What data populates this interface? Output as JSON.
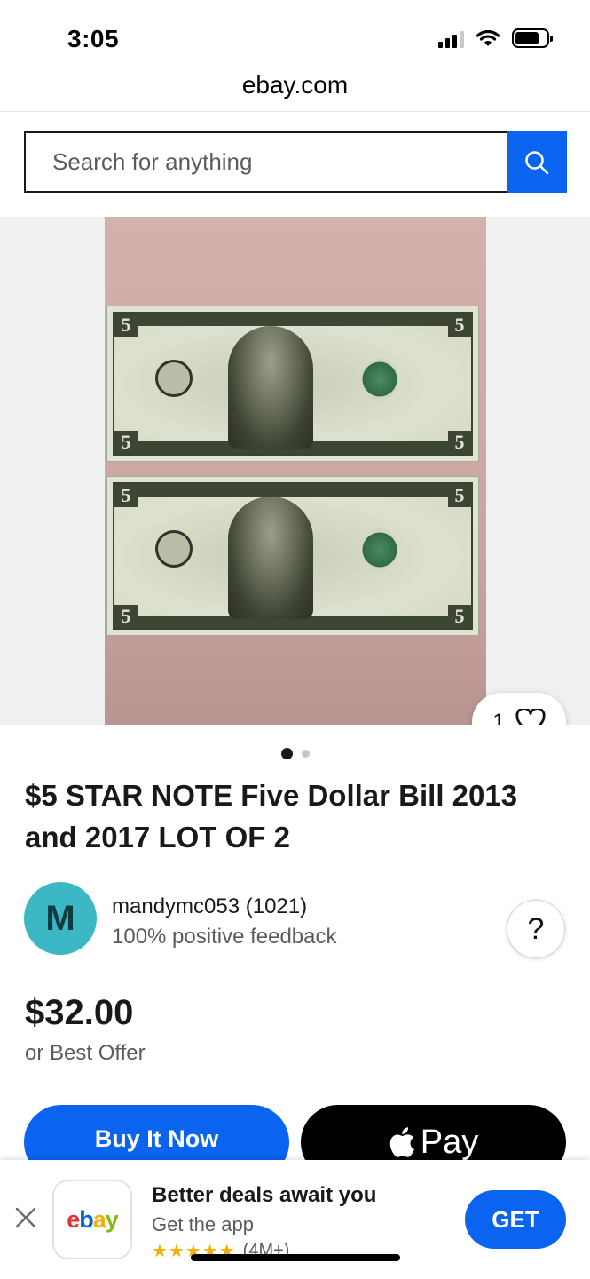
{
  "status_bar": {
    "time": "3:05",
    "battery_level": 0.75
  },
  "browser": {
    "url": "ebay.com"
  },
  "search": {
    "placeholder": "Search for anything",
    "button_icon": "search-icon"
  },
  "gallery": {
    "watch_count": "1",
    "watch_icon": "heart-icon",
    "total_images": 2,
    "active_image": 1
  },
  "listing": {
    "title": "$5 STAR NOTE Five Dollar Bill 2013 and 2017 LOT OF 2",
    "price": "$32.00",
    "best_offer": "or Best Offer"
  },
  "seller": {
    "avatar_letter": "M",
    "avatar_color": "#3cb7c4",
    "name": "mandymc053 (1021)",
    "feedback": "100% positive feedback",
    "help_label": "?"
  },
  "actions": {
    "buy_now_label": "Buy It Now",
    "apple_pay_label": "Pay",
    "accent_color": "#0a64f0"
  },
  "app_banner": {
    "title": "Better deals await you",
    "subtitle": "Get the app",
    "stars": "★★★★★",
    "rating_count": "(4M+)",
    "get_label": "GET"
  }
}
